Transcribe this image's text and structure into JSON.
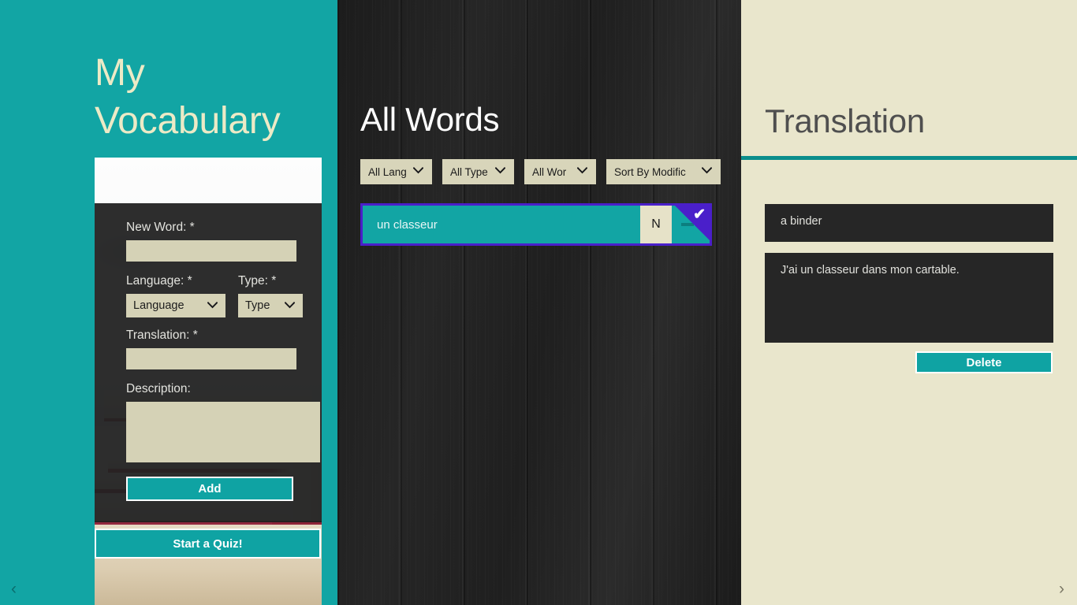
{
  "app": {
    "title_line1": "My",
    "title_line2": "Vocabulary"
  },
  "colors": {
    "teal": "#12a5a4",
    "teal_dark": "#0b8e8c",
    "cream": "#e9e6cc",
    "field_cream": "#d5d2b6",
    "purple_selection": "#4a1fca",
    "panel_dark": "#262626",
    "title_cream": "#eceac6"
  },
  "form": {
    "new_word": {
      "label": "New Word: *",
      "value": "",
      "placeholder": ""
    },
    "language": {
      "label": "Language: *",
      "selected": "Language",
      "caret": "chevron-down-icon"
    },
    "type": {
      "label": "Type: *",
      "selected": "Type",
      "caret": "chevron-down-icon"
    },
    "translation": {
      "label": "Translation: *",
      "value": "",
      "placeholder": ""
    },
    "description": {
      "label": "Description:",
      "value": "",
      "placeholder": ""
    },
    "add_button": "Add",
    "quiz_button": "Start a Quiz!"
  },
  "words_panel": {
    "title": "All Words",
    "filters": [
      {
        "label": "All Lang",
        "name": "filter-language"
      },
      {
        "label": "All Type",
        "name": "filter-type"
      },
      {
        "label": "All Wor",
        "name": "filter-word"
      },
      {
        "label": "Sort By Modific",
        "name": "filter-sort"
      }
    ],
    "items": [
      {
        "word": "un classeur",
        "badge": "N",
        "selected": true,
        "minus": "–",
        "check": "✔"
      }
    ]
  },
  "translation_panel": {
    "title": "Translation",
    "word": "a binder",
    "sentence": "J'ai un classeur dans mon cartable.",
    "delete_button": "Delete"
  },
  "nav": {
    "back": "‹",
    "forward": "›"
  }
}
